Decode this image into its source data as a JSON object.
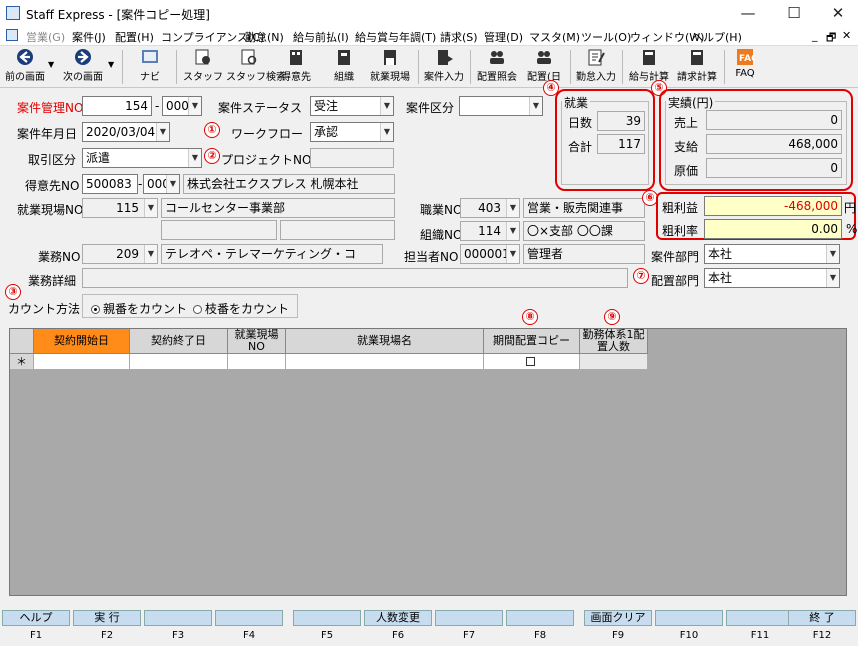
{
  "window": {
    "title": "Staff Express - [案件コピー処理]",
    "min": "—",
    "max": "☐",
    "close": "✕"
  },
  "menu": [
    {
      "label": "営業(G)",
      "disabled": true
    },
    {
      "label": "案件(J)"
    },
    {
      "label": "配置(H)"
    },
    {
      "label": "コンプライアンス(C)"
    },
    {
      "label": "勤怠(N)"
    },
    {
      "label": "給与前払(I)"
    },
    {
      "label": "給与賞与年調(T)"
    },
    {
      "label": "請求(S)"
    },
    {
      "label": "管理(D)"
    },
    {
      "label": "マスタ(M)"
    },
    {
      "label": "ツール(O)"
    },
    {
      "label": "ウィンドウ(W)"
    },
    {
      "label": "ヘルプ(H)"
    }
  ],
  "mdi": {
    "min": "_",
    "restore": "🗗",
    "close": "✕"
  },
  "toolbar": [
    "前の画面",
    "次の画面",
    "ナビ",
    "スタッフ",
    "スタッフ検索",
    "得意先",
    "組織",
    "就業現場",
    "案件入力",
    "配置照会",
    "配置(日",
    "勤怠入力",
    "給与計算",
    "請求計算",
    "FAQ"
  ],
  "form": {
    "l_anken_no": "案件管理NO",
    "anken_no": "154",
    "anken_sub": "000",
    "l_status": "案件ステータス",
    "status": "受注",
    "l_kubun": "案件区分",
    "kubun": "",
    "l_date": "案件年月日",
    "date": "2020/03/04",
    "l_workflow": "ワークフロー",
    "workflow": "承認",
    "l_torihiki": "取引区分",
    "torihiki": "派遣",
    "l_project": "プロジェクトNO",
    "project": "",
    "l_tokui": "得意先NO",
    "tokui_no": "500083",
    "tokui_sub": "000",
    "tokui_name": "株式会社エクスプレス 札幌本社",
    "l_genba": "就業現場NO",
    "genba_no": "115",
    "genba_name": "コールセンター事業部",
    "l_shokushu": "職業NO",
    "shokushu_no": "403",
    "shokushu_name": "営業・販売関連事",
    "l_soshiki": "組織NO",
    "soshiki_no": "114",
    "soshiki_name": "〇×支部 〇〇課",
    "l_gyomu": "業務NO",
    "gyomu_no": "209",
    "gyomu_name": "テレオペ・テレマーケティング・コ",
    "l_tanto": "担当者NO",
    "tanto_no": "000001",
    "tanto_name": "管理者",
    "l_bumon": "案件部門",
    "bumon": "本社",
    "l_haichi": "配置部門",
    "haichi": "本社",
    "l_detail": "業務詳細",
    "detail": "",
    "l_count": "カウント方法",
    "radio1": "親番をカウント",
    "radio2": "枝番をカウント"
  },
  "shugyo": {
    "title": "就業",
    "l_days": "日数",
    "days": "39",
    "l_total": "合計",
    "total": "117"
  },
  "jisseki": {
    "title": "実績(円)",
    "l_uri": "売上",
    "uri": "0",
    "l_shikyu": "支給",
    "shikyu": "468,000",
    "l_genka": "原価",
    "genka": "0"
  },
  "profit": {
    "l_ari": "粗利益",
    "ari": "-468,000",
    "u1": "円",
    "l_rate": "粗利率",
    "rate": "0.00",
    "u2": "%"
  },
  "markers": [
    "①",
    "②",
    "③",
    "④",
    "⑤",
    "⑥",
    "⑦",
    "⑧",
    "⑨"
  ],
  "grid": {
    "headers": [
      "契約開始日",
      "契約終了日",
      "就業現場NO",
      "就業現場名",
      "期間配置コピー",
      "勤務体系1配置人数"
    ],
    "newrow": "＊"
  },
  "fkeys": [
    {
      "label": "ヘルプ",
      "key": "F1"
    },
    {
      "label": "実 行",
      "key": "F2"
    },
    {
      "label": "",
      "key": "F3"
    },
    {
      "label": "",
      "key": "F4"
    },
    {
      "label": "",
      "key": "F5"
    },
    {
      "label": "人数変更",
      "key": "F6"
    },
    {
      "label": "",
      "key": "F7"
    },
    {
      "label": "",
      "key": "F8"
    },
    {
      "label": "画面クリア",
      "key": "F9"
    },
    {
      "label": "",
      "key": "F10"
    },
    {
      "label": "",
      "key": "F11"
    },
    {
      "label": "終 了",
      "key": "F12"
    }
  ],
  "colors": {
    "accent_red": "#e00000",
    "header_orange": "#ff8c19",
    "profit_yellow": "#ffffc8",
    "fkey_blue": "#c8dcf0"
  }
}
